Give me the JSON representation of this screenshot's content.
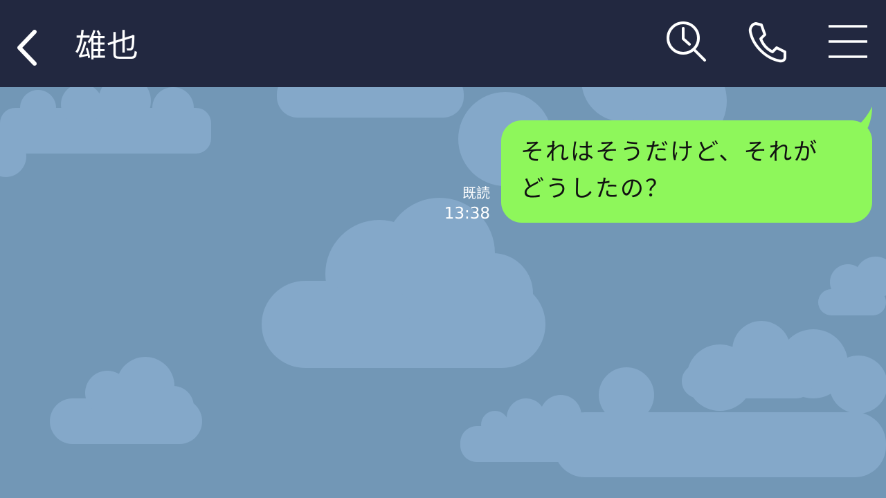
{
  "header": {
    "contact_name": "雄也",
    "background_color": "#222840"
  },
  "icons": {
    "back": "chevron-left-icon",
    "search": "search-clock-icon",
    "call": "phone-icon",
    "menu": "hamburger-menu-icon"
  },
  "chat": {
    "background_color": "#7297b6",
    "messages": [
      {
        "sender": "self",
        "text": "それはそうだけど、それが\nどうしたの？",
        "read_status": "既読",
        "time": "13:38",
        "bubble_color": "#8ef75b"
      }
    ]
  }
}
